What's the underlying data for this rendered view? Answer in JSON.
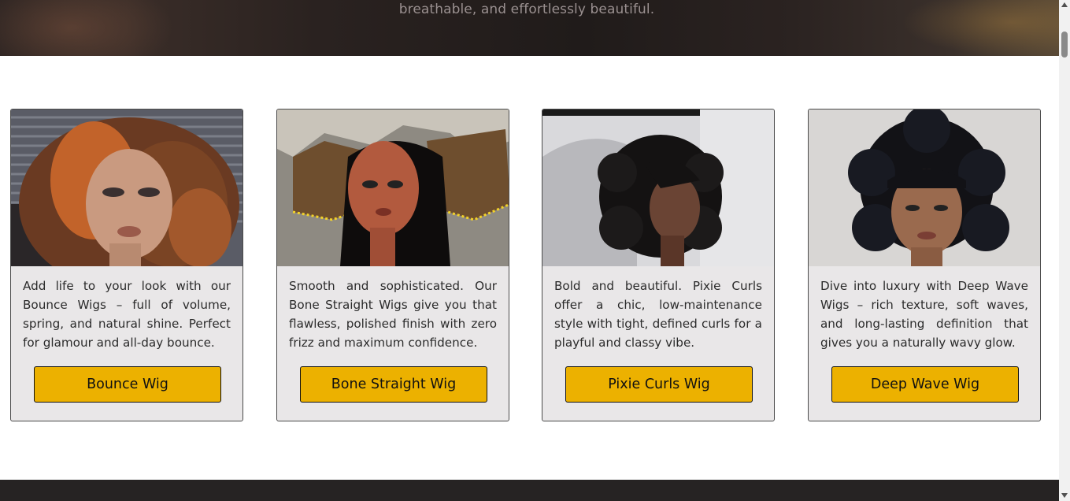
{
  "hero": {
    "text": "breathable, and effortlessly beautiful."
  },
  "cards": [
    {
      "description": "Add life to your look with our Bounce Wigs – full of volume, spring, and natural shine. Perfect for glamour and all-day bounce.",
      "button_label": "Bounce Wig",
      "image_icon": "bounce-wig-photo"
    },
    {
      "description": "Smooth and sophisticated. Our Bone Straight Wigs give you that flawless, polished finish with zero frizz and maximum confidence.",
      "button_label": "Bone Straight Wig",
      "image_icon": "bone-straight-wig-photo"
    },
    {
      "description": "Bold and beautiful. Pixie Curls offer a chic, low-maintenance style with tight, defined curls for a playful and classy vibe.",
      "button_label": "Pixie Curls Wig",
      "image_icon": "pixie-curls-wig-photo"
    },
    {
      "description": "Dive into luxury with Deep Wave Wigs – rich texture, soft waves, and long-lasting definition that gives you a naturally wavy glow.",
      "button_label": "Deep Wave Wig",
      "image_icon": "deep-wave-wig-photo"
    }
  ],
  "colors": {
    "button": "#ecb100",
    "card_bg": "#e9e7e8",
    "footer": "#262323"
  }
}
